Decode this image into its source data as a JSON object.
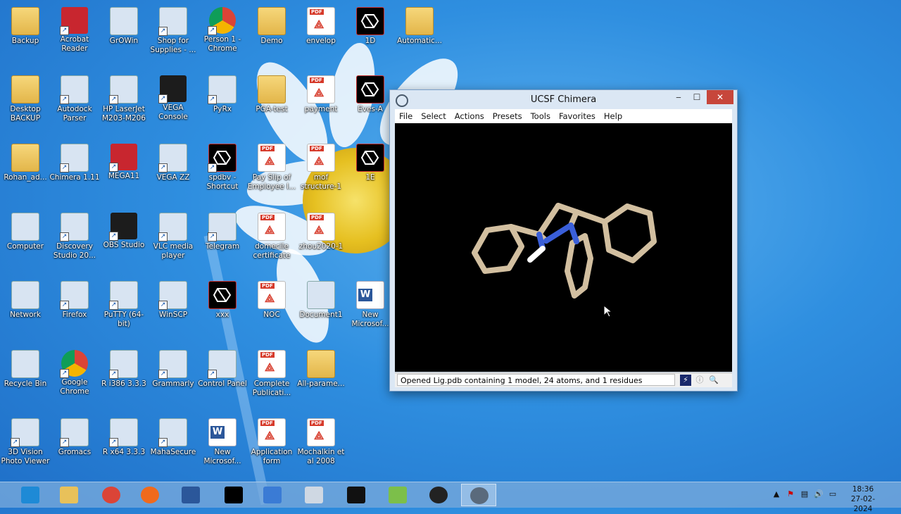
{
  "desktop": {
    "icons": [
      {
        "label": "Backup",
        "kind": "folder",
        "shortcut": false
      },
      {
        "label": "Acrobat Reader",
        "kind": "acrobat",
        "shortcut": true
      },
      {
        "label": "GrOWin",
        "kind": "generic",
        "shortcut": false
      },
      {
        "label": "Shop for Supplies - ...",
        "kind": "printer",
        "shortcut": true
      },
      {
        "label": "Person 1 - Chrome",
        "kind": "chrome",
        "shortcut": true
      },
      {
        "label": "Demo",
        "kind": "folder",
        "shortcut": false
      },
      {
        "label": "envelop",
        "kind": "pdf",
        "shortcut": false
      },
      {
        "label": "1D",
        "kind": "chimera",
        "shortcut": false
      },
      {
        "label": "Automatic...",
        "kind": "folder",
        "shortcut": false
      },
      {
        "label": "Desktop BACKUP",
        "kind": "folder",
        "shortcut": false
      },
      {
        "label": "Autodock Parser",
        "kind": "generic",
        "shortcut": true
      },
      {
        "label": "HP LaserJet M203-M206",
        "kind": "printer",
        "shortcut": true
      },
      {
        "label": "VEGA Console",
        "kind": "dark",
        "shortcut": true
      },
      {
        "label": "PyRx",
        "kind": "generic",
        "shortcut": true
      },
      {
        "label": "PGA-test",
        "kind": "folder",
        "shortcut": false
      },
      {
        "label": "payment",
        "kind": "pdf",
        "shortcut": false
      },
      {
        "label": "Eves-A",
        "kind": "chimera",
        "shortcut": false
      },
      {
        "label": "Rohan_ad...",
        "kind": "folder",
        "shortcut": false
      },
      {
        "label": "Chimera 1.11",
        "kind": "generic",
        "shortcut": true
      },
      {
        "label": "MEGA11",
        "kind": "red",
        "shortcut": true
      },
      {
        "label": "VEGA ZZ",
        "kind": "generic",
        "shortcut": true
      },
      {
        "label": "spdbv - Shortcut",
        "kind": "chimera",
        "shortcut": true
      },
      {
        "label": "Pay Slip of Employee I...",
        "kind": "pdf",
        "shortcut": false
      },
      {
        "label": "mof structure-1",
        "kind": "pdf",
        "shortcut": false
      },
      {
        "label": "1E",
        "kind": "chimera",
        "shortcut": false
      },
      {
        "label": "Computer",
        "kind": "generic",
        "shortcut": false
      },
      {
        "label": "Discovery Studio 20...",
        "kind": "generic",
        "shortcut": true
      },
      {
        "label": "OBS Studio",
        "kind": "dark",
        "shortcut": true
      },
      {
        "label": "VLC media player",
        "kind": "generic",
        "shortcut": true
      },
      {
        "label": "Telegram",
        "kind": "generic",
        "shortcut": true
      },
      {
        "label": "domecile certificate",
        "kind": "pdf",
        "shortcut": false
      },
      {
        "label": "zhou2020-1",
        "kind": "pdf",
        "shortcut": false
      },
      {
        "label": "Network",
        "kind": "generic",
        "shortcut": false
      },
      {
        "label": "Firefox",
        "kind": "generic",
        "shortcut": true
      },
      {
        "label": "PuTTY (64-bit)",
        "kind": "generic",
        "shortcut": true
      },
      {
        "label": "WinSCP",
        "kind": "generic",
        "shortcut": true
      },
      {
        "label": "xxx",
        "kind": "chimera",
        "shortcut": false
      },
      {
        "label": "NOC",
        "kind": "pdf",
        "shortcut": false
      },
      {
        "label": "Document1",
        "kind": "generic",
        "shortcut": false
      },
      {
        "label": "New Microsof...",
        "kind": "word",
        "shortcut": false
      },
      {
        "label": "Recycle Bin",
        "kind": "generic",
        "shortcut": false
      },
      {
        "label": "Google Chrome",
        "kind": "chrome",
        "shortcut": true
      },
      {
        "label": "R i386 3.3.3",
        "kind": "generic",
        "shortcut": true
      },
      {
        "label": "Grammarly",
        "kind": "generic",
        "shortcut": true
      },
      {
        "label": "Control Panel",
        "kind": "generic",
        "shortcut": true
      },
      {
        "label": "Complete Publicati...",
        "kind": "pdf",
        "shortcut": false
      },
      {
        "label": "All-parame...",
        "kind": "folder",
        "shortcut": false
      },
      {
        "label": "3D Vision Photo Viewer",
        "kind": "generic",
        "shortcut": true
      },
      {
        "label": "Gromacs",
        "kind": "generic",
        "shortcut": true
      },
      {
        "label": "R x64 3.3.3",
        "kind": "generic",
        "shortcut": true
      },
      {
        "label": "MahaSecure",
        "kind": "generic",
        "shortcut": true
      },
      {
        "label": "New Microsof...",
        "kind": "word",
        "shortcut": false
      },
      {
        "label": "Application form",
        "kind": "pdf",
        "shortcut": false
      },
      {
        "label": "Mochalkin et al 2008",
        "kind": "pdf",
        "shortcut": false
      }
    ]
  },
  "window": {
    "title": "UCSF Chimera",
    "controls": {
      "minimize": "‒",
      "maximize": "☐",
      "close": "✕"
    },
    "menu": [
      "File",
      "Select",
      "Actions",
      "Presets",
      "Tools",
      "Favorites",
      "Help"
    ],
    "status": "Opened Lig.pdb containing 1 model, 24 atoms, and 1 residues",
    "colors": {
      "carbon": "#d2bfa0",
      "nitrogen": "#3a5fd9",
      "hydrogen": "#ffffff",
      "background": "#000000"
    }
  },
  "taskbar": {
    "apps": [
      {
        "name": "internet-explorer-icon",
        "active": false
      },
      {
        "name": "file-explorer-icon",
        "active": false
      },
      {
        "name": "chrome-icon",
        "active": false
      },
      {
        "name": "firefox-icon",
        "active": false
      },
      {
        "name": "word-icon",
        "active": false
      },
      {
        "name": "chimera-icon",
        "active": false
      },
      {
        "name": "text-editor-icon",
        "active": false
      },
      {
        "name": "calculator-icon",
        "active": false
      },
      {
        "name": "terminal-icon",
        "active": false
      },
      {
        "name": "chart-app-icon",
        "active": false
      },
      {
        "name": "obs-icon",
        "active": false
      },
      {
        "name": "chimera-window-icon",
        "active": true
      }
    ],
    "clock": {
      "time": "18:36",
      "date": "27-02-2024"
    }
  }
}
